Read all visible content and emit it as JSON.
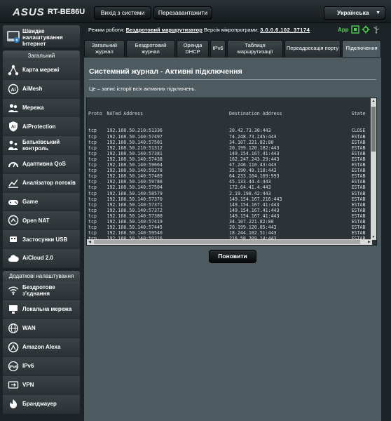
{
  "header": {
    "brand": "ASUS",
    "model": "RT-BE86U",
    "logout_label": "Вихід з системи",
    "reboot_label": "Перезавантажити",
    "language": "Українська"
  },
  "status": {
    "mode_label": "Режим роботи:",
    "mode_value": "Бездротовий маршрутизатор",
    "fw_label": "Версія мікропрограми:",
    "fw_value": "3.0.0.6.102_37174",
    "app_label": "App"
  },
  "sidebar": {
    "quick_label": "Швидке налаштування Інтернет",
    "general_title": "Загальний",
    "general_items": [
      {
        "label": "Карта мережі",
        "icon": "network-map-icon"
      },
      {
        "label": "AiMesh",
        "icon": "aimesh-icon"
      },
      {
        "label": "Мережа",
        "icon": "guest-network-icon"
      },
      {
        "label": "AiProtection",
        "icon": "shield-icon"
      },
      {
        "label": "Батьківський контроль",
        "icon": "parental-control-icon"
      },
      {
        "label": "Адаптивна QoS",
        "icon": "qos-gauge-icon"
      },
      {
        "label": "Аналізатор потоків",
        "icon": "traffic-analyzer-icon"
      },
      {
        "label": "Game",
        "icon": "gamepad-icon"
      },
      {
        "label": "Open NAT",
        "icon": "open-nat-icon"
      },
      {
        "label": "Застосунки USB",
        "icon": "usb-icon"
      },
      {
        "label": "AiCloud 2.0",
        "icon": "cloud-icon"
      }
    ],
    "advanced_title": "Додаткові налаштування",
    "advanced_items": [
      {
        "label": "Бездротове з'єднання",
        "icon": "wireless-icon"
      },
      {
        "label": "Локальна мережа",
        "icon": "lan-icon"
      },
      {
        "label": "WAN",
        "icon": "globe-icon"
      },
      {
        "label": "Amazon Alexa",
        "icon": "alexa-icon"
      },
      {
        "label": "IPv6",
        "icon": "ipv6-icon"
      },
      {
        "label": "VPN",
        "icon": "vpn-icon"
      },
      {
        "label": "Брандмауер",
        "icon": "firewall-icon"
      }
    ]
  },
  "tabs": [
    "Загальний журнал",
    "Бездротовий журнал",
    "Оренда DHCP",
    "IPv6",
    "Таблиця маршрутизації",
    "Переадресація порту",
    "Підключення"
  ],
  "panel": {
    "title": "Системний журнал - Активні підключення",
    "description": "Це – запис історії всіх активних підключень.",
    "apply_label": "Поновити"
  },
  "log": {
    "headers": [
      "Proto",
      "NATed Address",
      "Destination Address",
      "State"
    ],
    "rows": [
      [
        "tcp",
        "192.168.50.210:51336",
        "20.42.73.30:443",
        "CLOSE"
      ],
      [
        "tcp",
        "192.168.50.140:57497",
        "74.248.73.245:443",
        "ESTAB"
      ],
      [
        "tcp",
        "192.168.50.140:57501",
        "34.107.221.82:80",
        "ESTAB"
      ],
      [
        "tcp",
        "192.168.50.210:51312",
        "20.199.120.182:443",
        "ESTAB"
      ],
      [
        "tcp",
        "192.168.50.140:57381",
        "149.154.167.41:443",
        "ESTAB"
      ],
      [
        "tcp",
        "192.168.50.140:57438",
        "162.247.243.29:443",
        "ESTAB"
      ],
      [
        "tcp",
        "192.168.50.140:59664",
        "47.246.110.43:443",
        "ESTAB"
      ],
      [
        "tcp",
        "192.168.50.140:59278",
        "35.190.49.118:443",
        "ESTAB"
      ],
      [
        "tcp",
        "192.168.50.140:57489",
        "64.233.164.109:993",
        "ESTAB"
      ],
      [
        "tcp",
        "192.168.50.140:59786",
        "45.133.44.4:443",
        "ESTAB"
      ],
      [
        "tcp",
        "192.168.50.140:57504",
        "172.64.41.4:443",
        "ESTAB"
      ],
      [
        "tcp",
        "192.168.50.140:58579",
        "2.19.198.42:443",
        "ESTAB"
      ],
      [
        "tcp",
        "192.168.50.140:57370",
        "149.154.167.216:443",
        "ESTAB"
      ],
      [
        "tcp",
        "192.168.50.140:57371",
        "149.154.167.41:443",
        "ESTAB"
      ],
      [
        "tcp",
        "192.168.50.140:57372",
        "149.154.167.41:443",
        "ESTAB"
      ],
      [
        "tcp",
        "192.168.50.140:57380",
        "149.154.167.41:443",
        "ESTAB"
      ],
      [
        "tcp",
        "192.168.50.140:57419",
        "34.107.221.82:80",
        "ESTAB"
      ],
      [
        "tcp",
        "192.168.50.140:57445",
        "20.199.120.85:443",
        "ESTAB"
      ],
      [
        "tcp",
        "192.168.50.140:59540",
        "18.244.102.51:443",
        "ESTAB"
      ],
      [
        "tcp",
        "192.168.50.140:59316",
        "216.58.209.14:443",
        "ESTAB"
      ],
      [
        "tcp",
        "192.168.50.210:51305",
        "20.199.120.85:443",
        "ESTAB"
      ],
      [
        "tcp",
        "192.168.50.140:58518",
        "35.190.25.25:443",
        "ESTAB"
      ],
      [
        "tcp",
        "192.168.50.140:59273",
        "40.117.192.222:443",
        "ESTAB"
      ]
    ]
  },
  "colors": {
    "background": "#1c2326",
    "panel": "#4d5b61",
    "log_background": "#2b3336",
    "accent_green": "#4cd14c"
  }
}
